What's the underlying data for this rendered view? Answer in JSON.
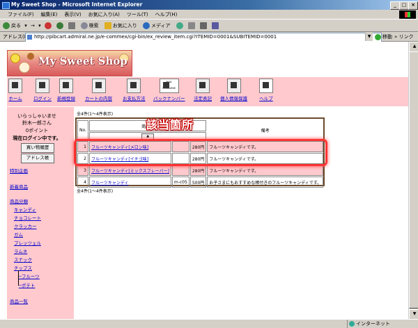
{
  "window": {
    "title": "My Sweet Shop - Microsoft Internet Explorer"
  },
  "menu": [
    "ファイル(F)",
    "編集(E)",
    "表示(V)",
    "お気に入り(A)",
    "ツール(T)",
    "ヘルプ(H)"
  ],
  "toolbar": {
    "back": "戻る",
    "forward": "→",
    "search": "検索",
    "favorites": "お気に入り",
    "media": "メディア"
  },
  "address": {
    "label": "アドレス(D)",
    "url": "http://pibcart.admiral.ne.jp/e-commex/cgi-bin/ex_review_item.cgi?ITEMID=0001&SUBITEMID=0001",
    "go": "移動",
    "links": "リンク"
  },
  "shop": {
    "logo": "My Sweet Shop"
  },
  "nav": [
    "ホーム",
    "ログイン",
    "新規登録",
    "カートの内容",
    "お支払方法",
    "バックナンバー",
    "法定表記",
    "個人情報保護",
    "ヘルプ"
  ],
  "nav_badge": "MAIL MAGAZINE",
  "sidebar": {
    "welcome": "いらっしゃいませ",
    "user": "鈴木一郎さん",
    "points": "0ポイント",
    "login_status": "現在ログイン中です。",
    "history_button": "買い物履歴",
    "address_button": "アドレス帳",
    "special": "特別企画",
    "new_items": "新着商品",
    "category_title": "商品分類",
    "categories": [
      "キャンディ",
      "チョコレート",
      "クラッカー",
      "ガム",
      "プレッツェル",
      "ラムネ",
      "スナック",
      "チップス"
    ],
    "subcategories": [
      "フルーツ",
      "ポテト"
    ],
    "all_items": "商品一覧"
  },
  "results": {
    "count_top": "全4件(1〜4件表示)",
    "count_bottom": "全4件(1〜4件表示)",
    "headers": {
      "no": "No.",
      "name": "商品名",
      "note": "備考"
    },
    "rows": [
      {
        "no": "1",
        "name": "フルーツキャンディ[メロン味]",
        "code": "",
        "price": "280円",
        "note": "フルーツキャンディです。"
      },
      {
        "no": "2",
        "name": "フルーツキャンディ[イチゴ味]",
        "code": "",
        "price": "280円",
        "note": "フルーツキャンディです。"
      },
      {
        "no": "3",
        "name": "フルーツキャンディ[ミックスフレーバー]",
        "code": "",
        "price": "280円",
        "note": "フルーツキャンディです。"
      },
      {
        "no": "4",
        "name": "フルーツキャンディ",
        "code": "m-c05",
        "price": "500円",
        "note": "お子さまにもおすすめな棒付きのフルーツキャンディです。"
      }
    ]
  },
  "annotation": {
    "text": "該当箇所",
    "color": "#ff3333"
  },
  "status": {
    "zone": "インターネット"
  }
}
